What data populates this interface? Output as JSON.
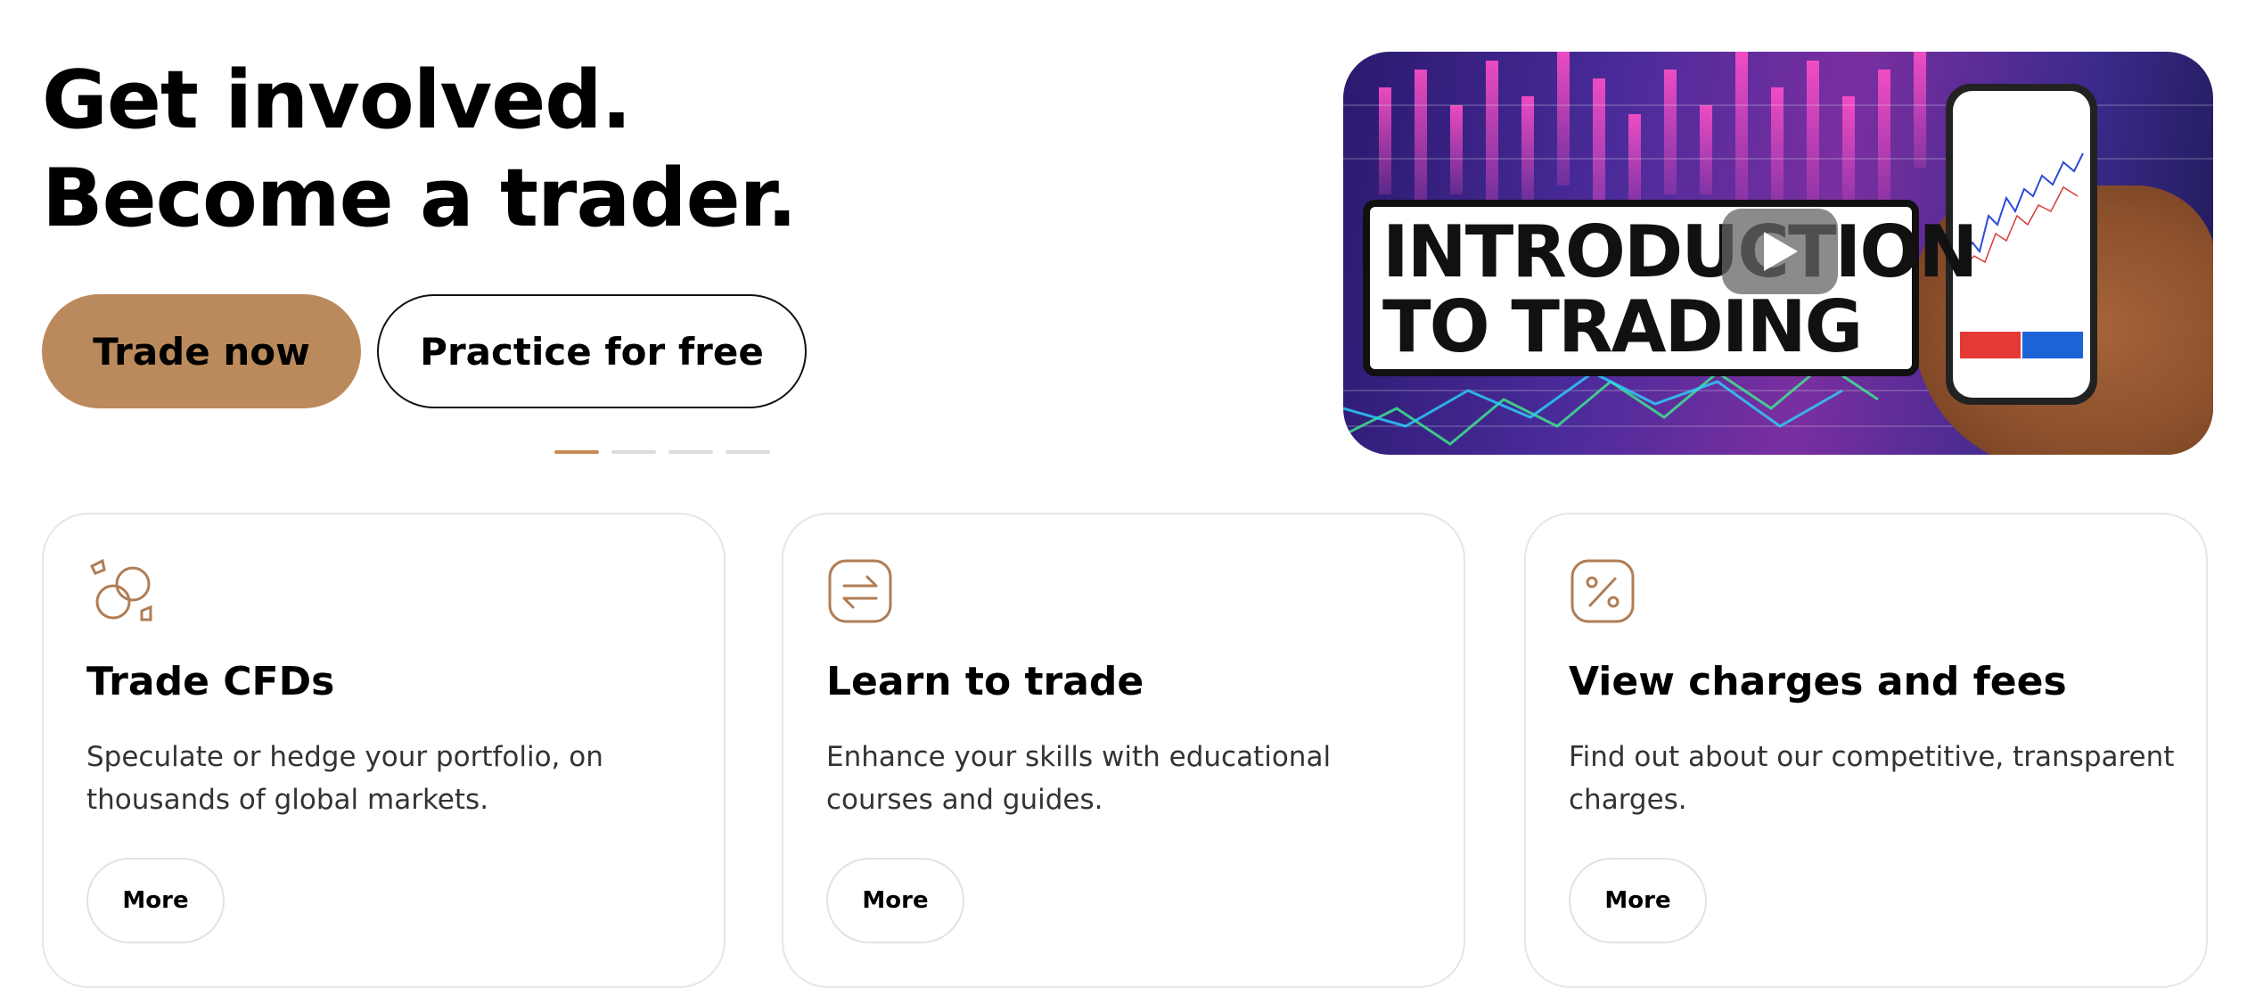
{
  "hero": {
    "title_line1": "Get involved.",
    "title_line2": "Become a trader.",
    "primary_button": "Trade now",
    "secondary_button": "Practice for free",
    "carousel": {
      "total": 4,
      "active": 1
    }
  },
  "video": {
    "line1": "INTRODUCTION",
    "line2": "TO TRADING",
    "play_icon": "play-icon"
  },
  "cards": [
    {
      "icon": "coins-icon",
      "title": "Trade CFDs",
      "description": "Speculate or hedge your portfolio, on thousands of global markets.",
      "button": "More"
    },
    {
      "icon": "exchange-arrows-icon",
      "title": "Learn to trade",
      "description": "Enhance your skills with educational courses and guides.",
      "button": "More"
    },
    {
      "icon": "percent-icon",
      "title": "View charges and fees",
      "description": "Find out about our competitive, transparent charges.",
      "button": "More"
    }
  ],
  "colors": {
    "accent": "#bb8a5c",
    "dot_active": "#c98a56",
    "dot_inactive": "#dcdcdc",
    "card_border": "#e6e6e6"
  }
}
